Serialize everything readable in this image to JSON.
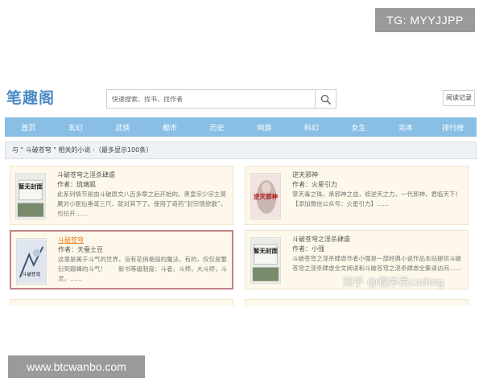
{
  "overlay": {
    "tg_label": "TG: MYYJJPP",
    "site_label": "www.btcwanbo.com"
  },
  "header": {
    "logo": "笔趣阁",
    "search_placeholder": "快速搜索、找书、找作者",
    "search_icon": "search-icon",
    "record_label": "阅读记录"
  },
  "nav": {
    "items": [
      "首页",
      "玄幻",
      "武侠",
      "都市",
      "历史",
      "网游",
      "科幻",
      "女生",
      "完本",
      "排行榜"
    ]
  },
  "results": {
    "heading": "与 \" 斗破苍穹 \" 相关的小说 -（最多显示100条）",
    "books": [
      {
        "title": "斗破苍穹之淫杀肆虐",
        "author": "作者：琉璃狐",
        "desc": "此系列情节是由斗破原文八百多章之后开始的。黑皇宗少宗主莫屠对小医仙垂涎三尺，就对其下了。使用了奇药“封宗情欲散”，也拉开……",
        "cover_text": "暂无封面",
        "highlight": false
      },
      {
        "title": "逆天邪神",
        "author": "作者：火星引力",
        "desc": "掌天毒之珠，承邪神之血，修逆天之力，一代邪神，君临天下！【添加微信公众号：火星引力】……",
        "cover_text": "逆天邪神",
        "highlight": false
      },
      {
        "title": "斗破苍穹",
        "author": "作者：天蚕土豆",
        "desc": "这里是属于斗气的世界，没有花俏艳丽的魔法，有的，仅仅是繁衍到巅峰的斗气！　　新书等级制度：斗者，斗师，大斗师，斗灵，……",
        "cover_text": "斗破苍穹",
        "highlight": true
      },
      {
        "title": "斗破苍穹之淫杀肆虐",
        "author": "作者：小强",
        "desc": "斗破苍穹之淫杀肆虐作者小强是一部经典小说作品本站提供斗破苍穹之淫杀肆虐全文阅读和斗破苍穹之淫杀肆虐全集请访问……",
        "cover_text": "暂无封面",
        "highlight": false
      }
    ]
  },
  "watermark": "知乎 @程序员coding"
}
